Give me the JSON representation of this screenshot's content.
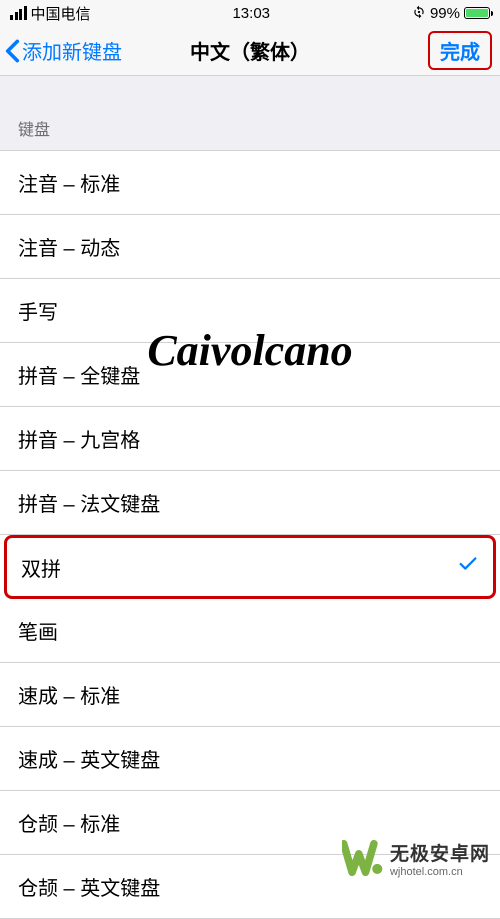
{
  "status": {
    "carrier": "中国电信",
    "time": "13:03",
    "battery_pct": "99%"
  },
  "nav": {
    "back_label": "添加新键盘",
    "title": "中文（繁体）",
    "done_label": "完成"
  },
  "section": {
    "header": "键盘"
  },
  "items": [
    {
      "label": "注音 – 标准",
      "selected": false
    },
    {
      "label": "注音 – 动态",
      "selected": false
    },
    {
      "label": "手写",
      "selected": false
    },
    {
      "label": "拼音 – 全键盘",
      "selected": false
    },
    {
      "label": "拼音 – 九宫格",
      "selected": false
    },
    {
      "label": "拼音 – 法文键盘",
      "selected": false
    },
    {
      "label": "双拼",
      "selected": true
    },
    {
      "label": "笔画",
      "selected": false
    },
    {
      "label": "速成 – 标准",
      "selected": false
    },
    {
      "label": "速成 – 英文键盘",
      "selected": false
    },
    {
      "label": "仓颉 – 标准",
      "selected": false
    },
    {
      "label": "仓颉 – 英文键盘",
      "selected": false
    }
  ],
  "watermark": {
    "text": "Caivolcano",
    "logo_main": "无极安卓网",
    "logo_sub": "wjhotel.com.cn"
  }
}
